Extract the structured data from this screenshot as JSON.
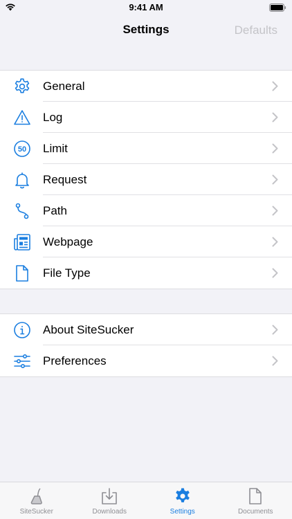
{
  "status": {
    "time": "9:41 AM"
  },
  "nav": {
    "title": "Settings",
    "right_label": "Defaults"
  },
  "groups": [
    {
      "items": [
        {
          "label": "General",
          "icon": "gear-icon"
        },
        {
          "label": "Log",
          "icon": "warning-icon"
        },
        {
          "label": "Limit",
          "icon": "limit-50-icon",
          "icon_text": "50"
        },
        {
          "label": "Request",
          "icon": "bell-icon"
        },
        {
          "label": "Path",
          "icon": "path-icon"
        },
        {
          "label": "Webpage",
          "icon": "newspaper-icon"
        },
        {
          "label": "File Type",
          "icon": "document-icon"
        }
      ]
    },
    {
      "items": [
        {
          "label": "About SiteSucker",
          "icon": "info-icon"
        },
        {
          "label": "Preferences",
          "icon": "sliders-icon"
        }
      ]
    }
  ],
  "tabs": [
    {
      "label": "SiteSucker",
      "icon": "vacuum-icon",
      "active": false
    },
    {
      "label": "Downloads",
      "icon": "download-icon",
      "active": false
    },
    {
      "label": "Settings",
      "icon": "gear-filled-icon",
      "active": true
    },
    {
      "label": "Documents",
      "icon": "document-icon",
      "active": false
    }
  ],
  "colors": {
    "accent": "#1a7ee0",
    "inactive": "#8e8e93",
    "background": "#f2f2f7"
  }
}
